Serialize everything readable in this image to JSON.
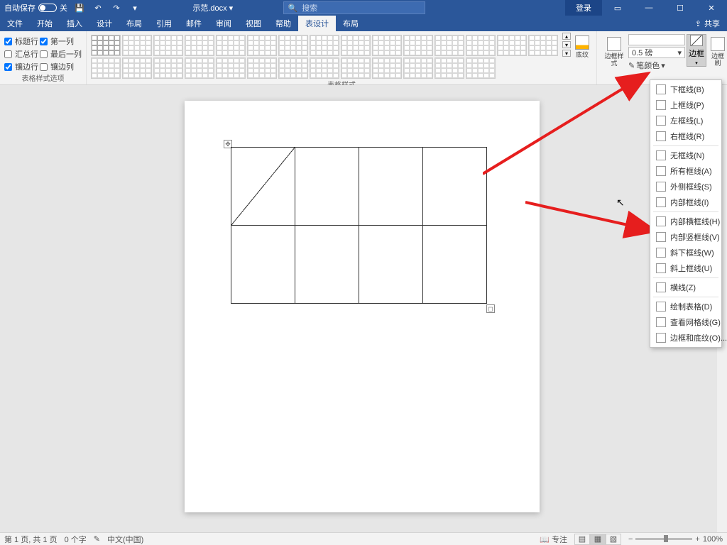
{
  "titlebar": {
    "autosave_label": "自动保存",
    "autosave_state": "关",
    "doc_title": "示范.docx ▾",
    "search_placeholder": "搜索",
    "login": "登录"
  },
  "tabs": {
    "file": "文件",
    "home": "开始",
    "insert": "插入",
    "design": "设计",
    "layout": "布局",
    "references": "引用",
    "mail": "邮件",
    "review": "审阅",
    "view": "视图",
    "help": "帮助",
    "table_design": "表设计",
    "table_layout": "布局",
    "share": "共享"
  },
  "style_options": {
    "header_row": "标题行",
    "first_col": "第一列",
    "total_row": "汇总行",
    "last_col": "最后一列",
    "banded_row": "镶边行",
    "banded_col": "镶边列",
    "group_label": "表格样式选项"
  },
  "styles": {
    "group_label": "表格样式",
    "shading": "底纹"
  },
  "borders": {
    "style_label": "边框样式",
    "weight": "0.5 磅",
    "pen_color": "笔颜色",
    "borders_btn": "边框",
    "painter": "边框刷"
  },
  "dropdown": {
    "bottom": "下框线(B)",
    "top": "上框线(P)",
    "left": "左框线(L)",
    "right": "右框线(R)",
    "none": "无框线(N)",
    "all": "所有框线(A)",
    "outside": "外侧框线(S)",
    "inside": "内部框线(I)",
    "inside_h": "内部横框线(H)",
    "inside_v": "内部竖框线(V)",
    "diag_down": "斜下框线(W)",
    "diag_up": "斜上框线(U)",
    "hline": "横线(Z)",
    "draw_table": "绘制表格(D)",
    "view_grid": "查看网格线(G)",
    "borders_shading": "边框和底纹(O)..."
  },
  "statusbar": {
    "page": "第 1 页, 共 1 页",
    "words": "0 个字",
    "lang_icon": "",
    "lang": "中文(中国)",
    "focus": "专注",
    "zoom": "100%"
  }
}
